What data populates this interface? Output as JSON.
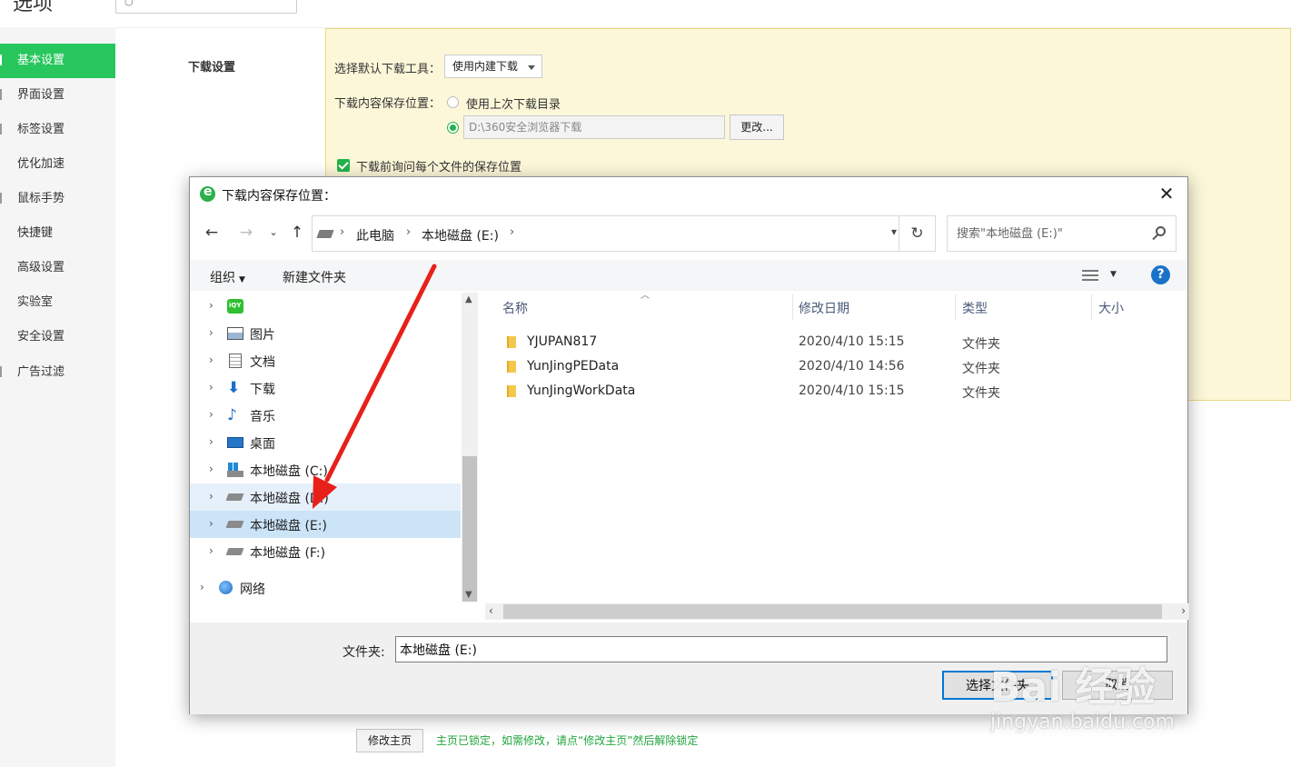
{
  "page": {
    "title": "选项",
    "homepage_button": "修改主页",
    "homepage_note": "主页已锁定，如需修改，请点“修改主页”然后解除锁定"
  },
  "sidebar": {
    "items": [
      {
        "label": "基本设置",
        "active": true
      },
      {
        "label": "界面设置"
      },
      {
        "label": "标签设置"
      },
      {
        "label": "优化加速"
      },
      {
        "label": "鼠标手势"
      },
      {
        "label": "快捷键"
      },
      {
        "label": "高级设置"
      },
      {
        "label": "实验室"
      },
      {
        "label": "安全设置"
      },
      {
        "label": "广告过滤"
      }
    ]
  },
  "download": {
    "section_title": "下载设置",
    "tool_label": "选择默认下载工具：",
    "tool_value": "使用内建下载",
    "location_label": "下载内容保存位置：",
    "option_last": "使用上次下载目录",
    "path_value": "D:\\360安全浏览器下载",
    "change_button": "更改...",
    "ask_each": "下载前询问每个文件的保存位置"
  },
  "dialog": {
    "title": "下载内容保存位置：",
    "breadcrumb": [
      "此电脑",
      "本地磁盘 (E:)"
    ],
    "search_placeholder": "搜索\"本地磁盘 (E:)\"",
    "toolbar": {
      "organize": "组织",
      "new_folder": "新建文件夹"
    },
    "tree": [
      {
        "label": "",
        "icon": "iqiyi"
      },
      {
        "label": "图片",
        "icon": "pictures"
      },
      {
        "label": "文档",
        "icon": "documents"
      },
      {
        "label": "下载",
        "icon": "downloads"
      },
      {
        "label": "音乐",
        "icon": "music"
      },
      {
        "label": "桌面",
        "icon": "desktop"
      },
      {
        "label": "本地磁盘 (C:)",
        "icon": "system-drive"
      },
      {
        "label": "本地磁盘 (D:)",
        "icon": "drive",
        "state": "hover"
      },
      {
        "label": "本地磁盘 (E:)",
        "icon": "drive",
        "state": "selected"
      },
      {
        "label": "本地磁盘 (F:)",
        "icon": "drive"
      },
      {
        "label": "网络",
        "icon": "network"
      }
    ],
    "columns": [
      "名称",
      "修改日期",
      "类型",
      "大小"
    ],
    "files": [
      {
        "name": "YJUPAN817",
        "date": "2020/4/10 15:15",
        "type": "文件夹"
      },
      {
        "name": "YunJingPEData",
        "date": "2020/4/10 14:56",
        "type": "文件夹"
      },
      {
        "name": "YunJingWorkData",
        "date": "2020/4/10 15:15",
        "type": "文件夹"
      }
    ],
    "folder_label": "文件夹:",
    "folder_value": "本地磁盘 (E:)",
    "select_button": "选择文件夹",
    "cancel_button": "取消"
  },
  "watermark": {
    "brand": "Bai 经验",
    "url": "jingyan.baidu.com"
  },
  "colors": {
    "accent_green": "#28c75e",
    "panel_yellow": "#fdf7d9",
    "annotation_red": "#e8201a",
    "help_blue": "#1a73c9"
  }
}
